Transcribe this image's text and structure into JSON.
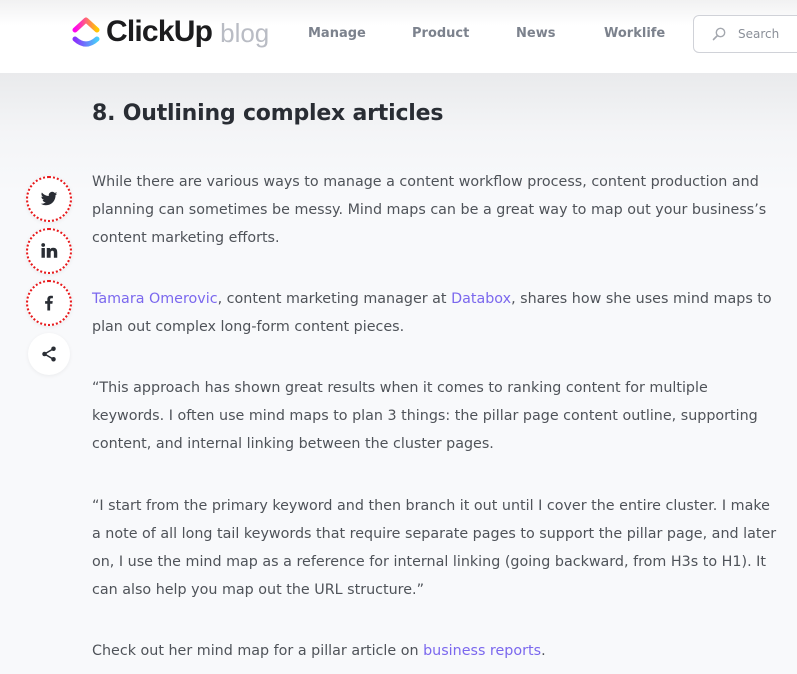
{
  "header": {
    "logo_text": "ClickUp",
    "logo_suffix": "blog",
    "nav": [
      "Manage",
      "Product",
      "News",
      "Worklife"
    ],
    "search_placeholder": "Search"
  },
  "share": {
    "items": [
      "twitter",
      "linkedin",
      "facebook",
      "share"
    ]
  },
  "article": {
    "heading": "8. Outlining complex articles",
    "p1": "While there are various ways to manage a content workflow process, content production and planning can sometimes be messy. Mind maps can be a great way to map out your business’s content marketing efforts.",
    "p2": {
      "link1": "Tamara Omerovic",
      "text1": ", content marketing manager at ",
      "link2": "Databox",
      "text2": ", shares how she uses mind maps to plan out complex long-form content pieces."
    },
    "p3": "“This approach has shown great results when it comes to ranking content for multiple keywords. I often use mind maps to plan 3 things: the pillar page content outline, supporting content, and internal linking between the cluster pages.",
    "p4": "“I start from the primary keyword and then branch it out until I cover the entire cluster. I make a note of all long tail keywords that require separate pages to support the pillar page, and later on, I use the mind map as a reference for internal linking (going backward, from H3s to H1). It can also help you map out the URL structure.”",
    "p5": {
      "text": "Check out her mind map for a pillar article on ",
      "link": "business reports",
      "end": "."
    }
  },
  "colors": {
    "link": "#7b68ee",
    "heading": "#292d34",
    "body": "#4f5359",
    "nav": "#7c828d",
    "focus_ring": "#e8191c"
  }
}
